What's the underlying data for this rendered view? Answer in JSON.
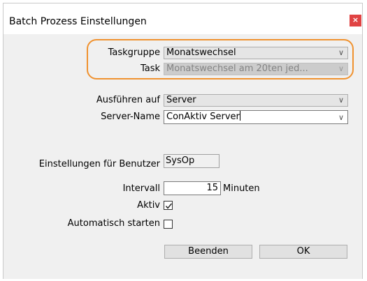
{
  "window": {
    "title": "Batch Prozess Einstellungen",
    "close_glyph": "×"
  },
  "form": {
    "taskgruppe_label": "Taskgruppe",
    "taskgruppe_value": "Monatswechsel",
    "task_label": "Task",
    "task_value": "Monatswechsel am 20ten jed...",
    "ausfuehren_label": "Ausführen auf",
    "ausfuehren_value": "Server",
    "servername_label": "Server-Name",
    "servername_value": "ConAktiv Server",
    "einstellungen_label": "Einstellungen für Benutzer",
    "benutzer_value": "SysOp",
    "intervall_label": "Intervall",
    "intervall_value": "15",
    "intervall_unit": "Minuten",
    "aktiv_label": "Aktiv",
    "aktiv_checked": true,
    "autostart_label": "Automatisch starten",
    "autostart_checked": false
  },
  "buttons": {
    "beenden": "Beenden",
    "ok": "OK"
  },
  "icons": {
    "dropdown": "chevron-down-icon",
    "close": "close-icon",
    "check": "checkmark-icon"
  },
  "colors": {
    "highlight": "#f0922f",
    "close_button": "#e04343",
    "client_background": "#f0f0f0"
  }
}
